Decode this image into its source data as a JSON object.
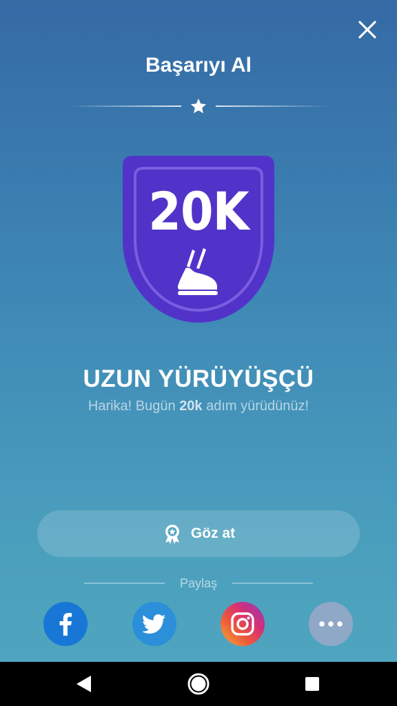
{
  "header": {
    "title": "Başarıyı Al",
    "close_icon": "close-icon"
  },
  "achievement": {
    "badge_text": "20K",
    "badge_color": "#5233c9",
    "name": "UZUN YÜRÜYÜŞÇÜ",
    "description_prefix": "Harika! Bugün ",
    "description_highlight": "20k",
    "description_suffix": " adım yürüdünüz!"
  },
  "actions": {
    "view_label": "Göz at",
    "view_icon": "award-icon"
  },
  "share": {
    "label": "Paylaş",
    "items": [
      {
        "name": "facebook",
        "icon": "facebook-icon",
        "color": "#1877d6"
      },
      {
        "name": "twitter",
        "icon": "twitter-icon",
        "color": "#2b8fd9"
      },
      {
        "name": "instagram",
        "icon": "instagram-icon",
        "color": "#d62f76"
      },
      {
        "name": "more",
        "icon": "more-icon",
        "color": "#8fa8c6"
      }
    ]
  },
  "navbar": {
    "buttons": [
      "back",
      "home",
      "recents"
    ]
  }
}
